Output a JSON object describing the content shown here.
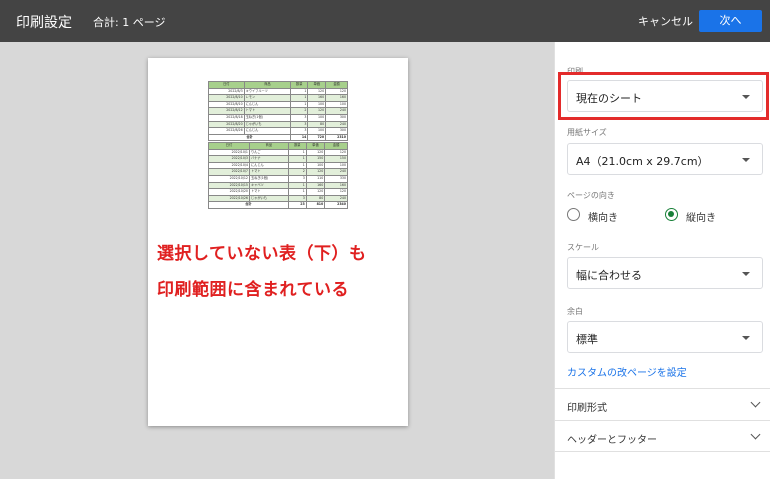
{
  "header": {
    "title": "印刷設定",
    "total": "合計: 1 ページ",
    "cancel_label": "キャンセル",
    "next_label": "次へ"
  },
  "preview": {
    "annotation_line1": "選択していない表（下）も",
    "annotation_line2": "印刷範囲に含まれている",
    "annotation_color": "#e02020",
    "table1": {
      "headers": [
        "日付",
        "商品",
        "数量",
        "単価",
        "金額"
      ],
      "rows": [
        [
          "2022/8/3",
          "キウイフルーツ",
          "1",
          "120",
          "120"
        ],
        [
          "2022/8/10",
          "レモン",
          "1",
          "160",
          "160"
        ],
        [
          "2022/8/10",
          "にんじん",
          "1",
          "100",
          "100"
        ],
        [
          "2022/8/12",
          "トマト",
          "2",
          "120",
          "240"
        ],
        [
          "2022/8/18",
          "玉ねぎ(1個)",
          "3",
          "100",
          "300"
        ],
        [
          "2022/8/20",
          "じゃがいも",
          "3",
          "80",
          "240"
        ],
        [
          "2022/8/26",
          "にんじん",
          "3",
          "100",
          "300"
        ]
      ],
      "total_label": "合計",
      "total_qty": "14",
      "total_price": "720",
      "total_amount": "2310"
    },
    "table2": {
      "headers": [
        "日付",
        "商品",
        "数量",
        "単価",
        "金額"
      ],
      "rows": [
        [
          "2022/10/1",
          "りんご",
          "1",
          "120",
          "120"
        ],
        [
          "2022/10/3",
          "バナナ",
          "1",
          "150",
          "150"
        ],
        [
          "2022/10/4",
          "にんじん",
          "1",
          "100",
          "100"
        ],
        [
          "2022/10/7",
          "トマト",
          "2",
          "120",
          "240"
        ],
        [
          "2022/10/12",
          "玉ねぎ(1個)",
          "3",
          "110",
          "330"
        ],
        [
          "2022/10/15",
          "キャベツ",
          "1",
          "160",
          "160"
        ],
        [
          "2022/10/20",
          "トマト",
          "1",
          "120",
          "120"
        ],
        [
          "2022/10/26",
          "じゃがいも",
          "3",
          "80",
          "240"
        ]
      ],
      "total_label": "合計",
      "total_qty": "23",
      "total_price": "810",
      "total_amount": "2340"
    }
  },
  "panel": {
    "print_label": "印刷",
    "print_value": "現在のシート",
    "paper_label": "用紙サイズ",
    "paper_value": "A4（21.0cm x 29.7cm）",
    "orientation_label": "ページの向き",
    "orientation_landscape": "横向き",
    "orientation_portrait": "縦向き",
    "orientation_selected": "縦向き",
    "scale_label": "スケール",
    "scale_value": "幅に合わせる",
    "margin_label": "余白",
    "margin_value": "標準",
    "custom_break_link": "カスタムの改ページを設定",
    "section_format": "印刷形式",
    "section_header_footer": "ヘッダーとフッター",
    "highlight_color": "#e32b2b",
    "accent_color": "#1a73e8"
  }
}
